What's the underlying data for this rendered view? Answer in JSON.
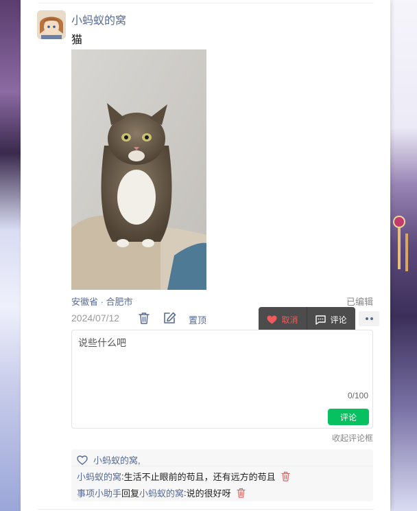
{
  "post": {
    "username": "小蚂蚁的窝",
    "text": "猫",
    "location": "安徽省 · 合肥市",
    "edited_label": "已编辑",
    "date": "2024/07/12",
    "pin_label": "置顶"
  },
  "popup": {
    "cancel_label": "取消",
    "comment_label": "评论"
  },
  "comment_form": {
    "placeholder": "说些什么吧",
    "counter": "0/100",
    "submit_label": "评论",
    "collapse_label": "收起评论框"
  },
  "likes": {
    "text": "小蚂蚁的窝,"
  },
  "comments": [
    {
      "author": "小蚂蚁的窝",
      "sep": ": ",
      "text": "生活不止眼前的苟且，还有远方的苟且"
    },
    {
      "author": "事项小助手",
      "reply_word": " 回复 ",
      "target": "小蚂蚁的窝",
      "sep": ": ",
      "text": "说的很好呀"
    }
  ],
  "colors": {
    "link": "#576b95",
    "accent_green": "#07c160",
    "delete_red": "#f15b5b"
  }
}
